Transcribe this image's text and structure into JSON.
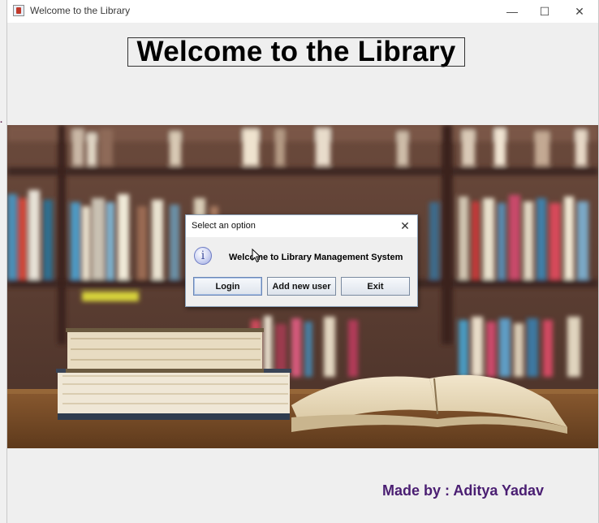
{
  "window": {
    "title": "Welcome to the Library",
    "controls": {
      "minimize": "—",
      "maximize": "☐",
      "close": "✕"
    }
  },
  "heading": "Welcome to the Library",
  "credits": "Made by : Aditya Yadav",
  "dialog": {
    "title": "Select an option",
    "close": "✕",
    "icon": "information-icon",
    "message": "Welcome to Library Management System",
    "buttons": [
      "Login",
      "Add new user",
      "Exit"
    ]
  },
  "background_image": "library bookshelves with stacked books and open book on wooden table",
  "colors": {
    "credits": "#4a1e72",
    "window_bg": "#efefef",
    "dialog_border": "#8aa0b8"
  }
}
